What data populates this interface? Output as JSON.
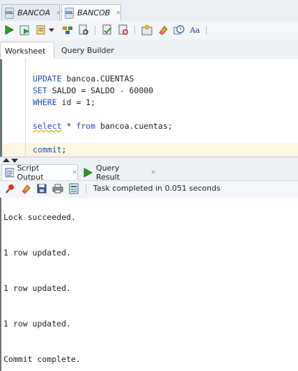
{
  "connection_tabs": [
    {
      "label": "BANCOA",
      "icon": "sql-connection-icon",
      "close": "×"
    },
    {
      "label": "BANCOB",
      "icon": "sql-connection-icon",
      "close": "×"
    }
  ],
  "worksheet_tabs": [
    "Worksheet",
    "Query Builder"
  ],
  "editor": {
    "lines": [
      {
        "kw": "UPDATE",
        "rest": " bancoa.CUENTAS"
      },
      {
        "kw": "SET",
        "rest": " SALDO = SALDO - 60000"
      },
      {
        "kw": "WHERE",
        "rest": " id = 1;"
      },
      {
        "kw": "select",
        "rest": " * from bancoa.cuentas;",
        "kw2": "from"
      },
      {
        "kw": "commit",
        "rest": ";"
      }
    ]
  },
  "output_tabs": [
    {
      "label": "Script Output",
      "icon": "script-output-icon",
      "close": "×"
    },
    {
      "label": "Query Result",
      "icon": "run-icon",
      "close": "×"
    }
  ],
  "output_toolbar": {
    "icons": [
      "pin-icon",
      "eraser-icon",
      "save-icon",
      "print-icon",
      "document-icon"
    ],
    "status": "Task completed in 0.051 seconds"
  },
  "output": {
    "lines": [
      "Lock succeeded.",
      "1 row updated.",
      "1 row updated.",
      "1 row updated.",
      "Commit complete."
    ]
  },
  "colors": {
    "keyword": "#1f4fb5",
    "run_green": "#2e9a2e",
    "current_line": "#fbf6e3"
  }
}
